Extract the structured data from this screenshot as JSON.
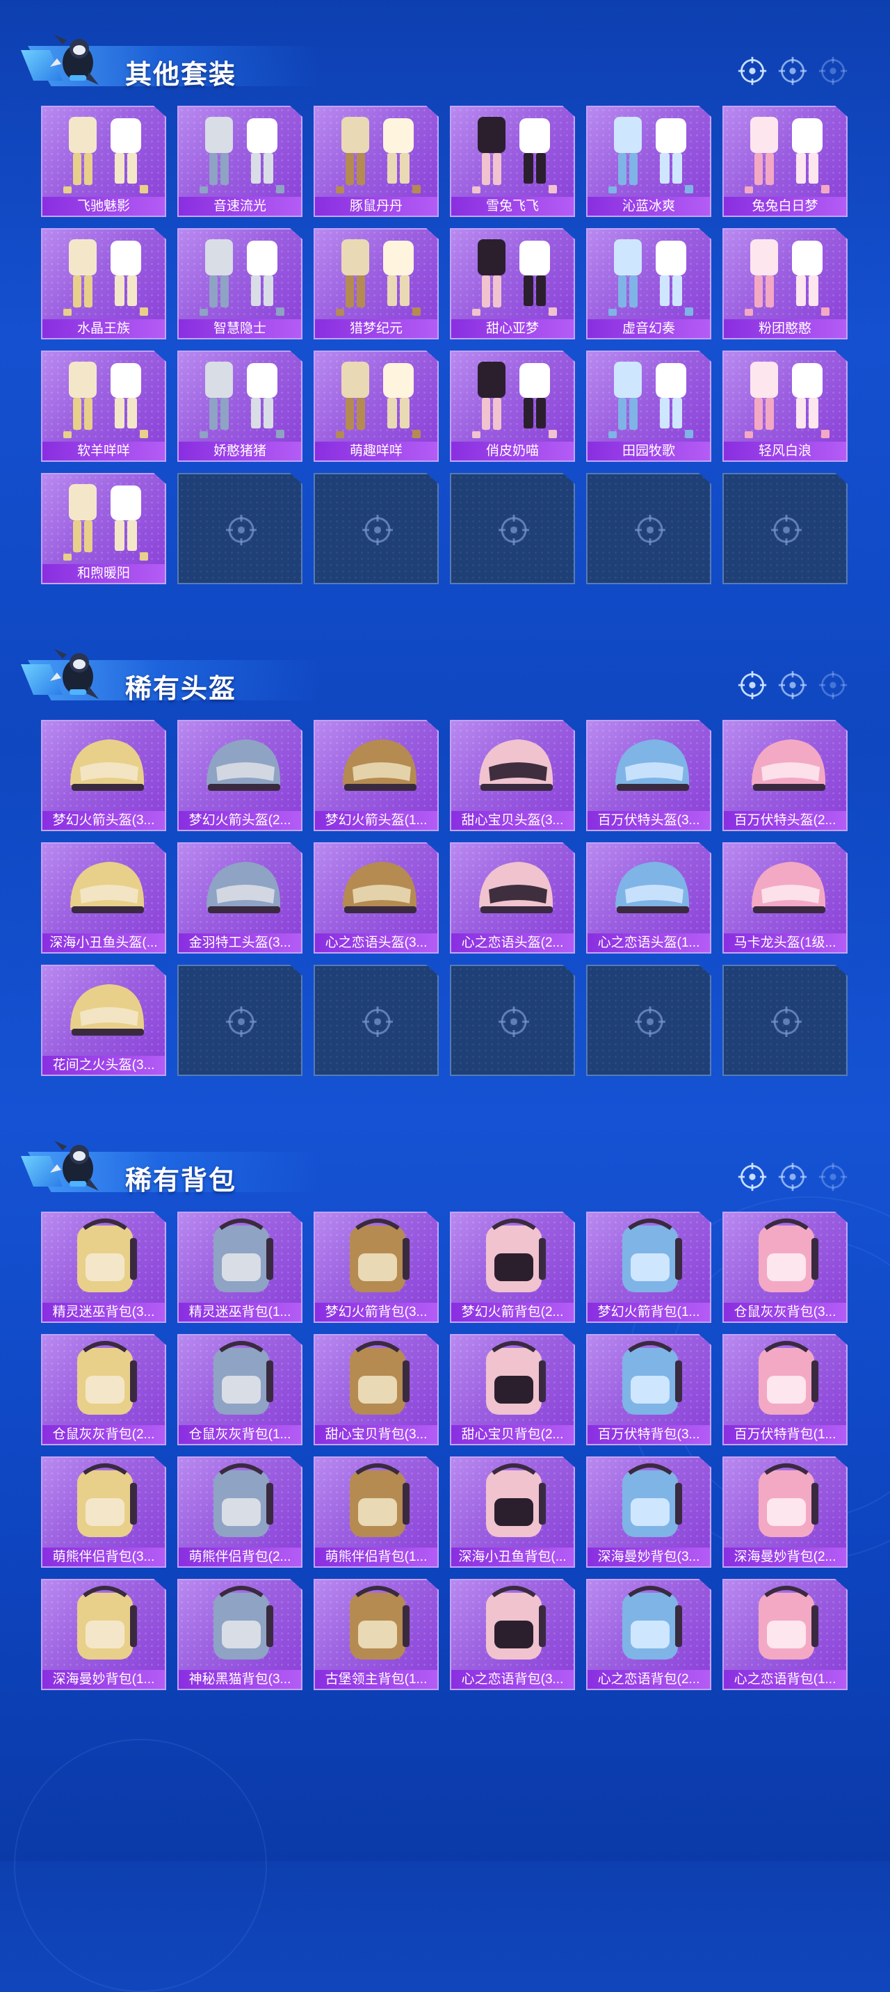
{
  "sections": [
    {
      "title": "其他套装",
      "items": [
        "飞驰魅影",
        "音速流光",
        "豚鼠丹丹",
        "雪兔飞飞",
        "沁蓝冰爽",
        "兔兔白日梦",
        "水晶王族",
        "智慧隐士",
        "猎梦纪元",
        "甜心亚梦",
        "虚音幻奏",
        "粉团憨憨",
        "软羊咩咩",
        "娇憨猪猪",
        "萌趣咩咩",
        "俏皮奶喵",
        "田园牧歌",
        "轻风白浪",
        "和煦暖阳"
      ],
      "empty_slots": 5
    },
    {
      "title": "稀有头盔",
      "items": [
        "梦幻火箭头盔(3...",
        "梦幻火箭头盔(2...",
        "梦幻火箭头盔(1...",
        "甜心宝贝头盔(3...",
        "百万伏特头盔(3...",
        "百万伏特头盔(2...",
        "深海小丑鱼头盔(...",
        "金羽特工头盔(3...",
        "心之恋语头盔(3...",
        "心之恋语头盔(2...",
        "心之恋语头盔(1...",
        "马卡龙头盔(1级...",
        "花间之火头盔(3..."
      ],
      "empty_slots": 5
    },
    {
      "title": "稀有背包",
      "items": [
        "精灵迷巫背包(3...",
        "精灵迷巫背包(1...",
        "梦幻火箭背包(3...",
        "梦幻火箭背包(2...",
        "梦幻火箭背包(1...",
        "仓鼠灰灰背包(3...",
        "仓鼠灰灰背包(2...",
        "仓鼠灰灰背包(1...",
        "甜心宝贝背包(3...",
        "甜心宝贝背包(2...",
        "百万伏特背包(3...",
        "百万伏特背包(1...",
        "萌熊伴侣背包(3...",
        "萌熊伴侣背包(2...",
        "萌熊伴侣背包(1...",
        "深海小丑鱼背包(...",
        "深海曼妙背包(3...",
        "深海曼妙背包(2...",
        "深海曼妙背包(1...",
        "神秘黑猫背包(3...",
        "古堡领主背包(1...",
        "心之恋语背包(3...",
        "心之恋语背包(2...",
        "心之恋语背包(1..."
      ],
      "empty_slots": 0
    }
  ],
  "colors": {
    "card_purple": "#9b5fe0",
    "label_purple": "#8a2fe0",
    "empty_slot": "#1f3f77",
    "background": "#1550d0"
  },
  "icons": {
    "header_marks": "crosshair-icon",
    "empty_slot": "crosshair-icon",
    "mascot": "mascot-icon"
  }
}
